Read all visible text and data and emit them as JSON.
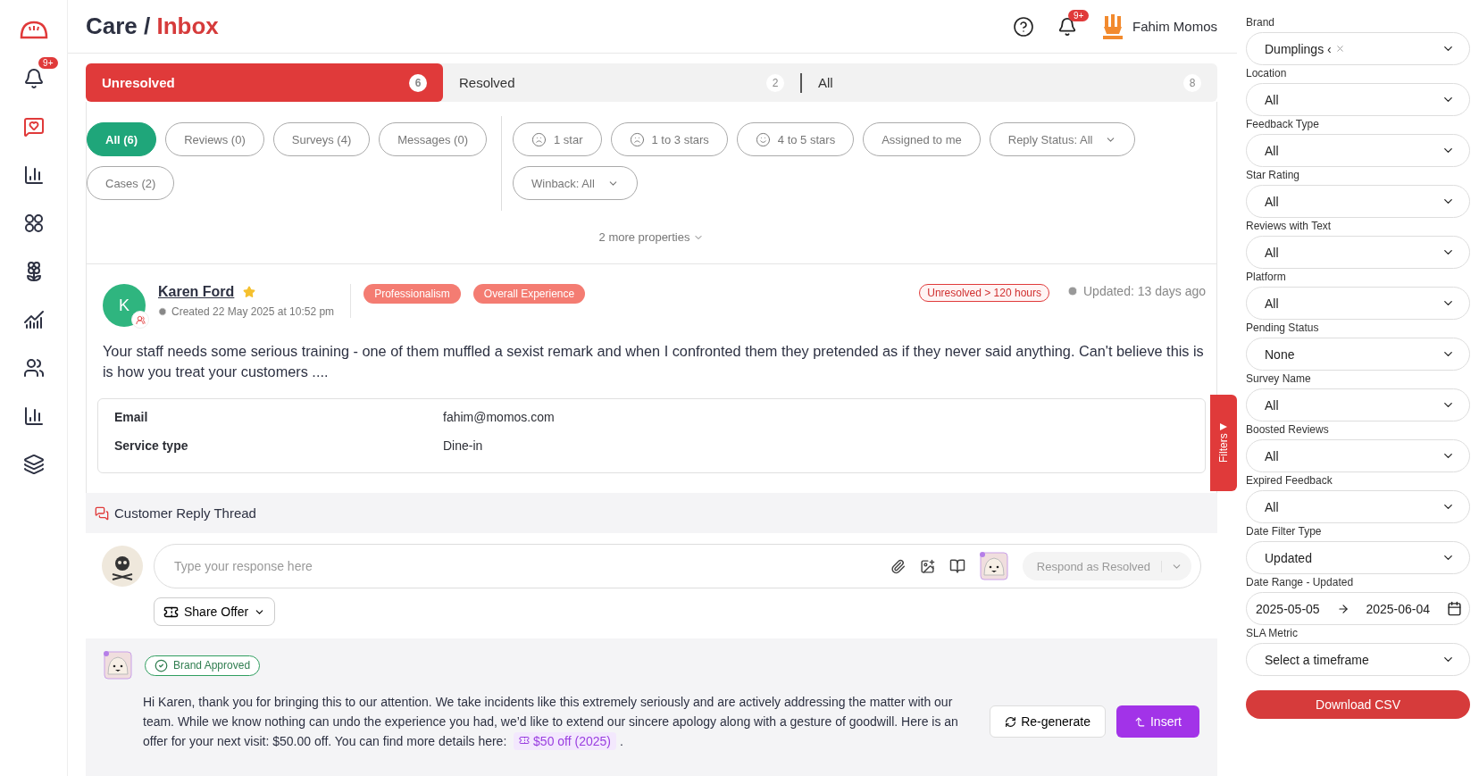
{
  "sidebar": {
    "items": [
      {
        "kind": "bell",
        "selected": false,
        "badge": "9+"
      },
      {
        "kind": "feedback",
        "selected": true
      },
      {
        "kind": "bars",
        "selected": false
      },
      {
        "kind": "apps",
        "selected": false
      },
      {
        "kind": "flower",
        "selected": false
      },
      {
        "kind": "growth",
        "selected": false
      },
      {
        "kind": "people",
        "selected": false
      },
      {
        "kind": "bars",
        "selected": false
      },
      {
        "kind": "layers",
        "selected": false
      }
    ]
  },
  "header": {
    "section": "Care /",
    "page": "Inbox",
    "notification_badge": "9+",
    "user_name": "Fahim Momos"
  },
  "status_tabs": [
    {
      "label": "Unresolved",
      "count": "6",
      "selected": true
    },
    {
      "label": "Resolved",
      "count": "2",
      "selected": false
    },
    {
      "label": "All",
      "count": "8",
      "selected": false
    }
  ],
  "type_chips": [
    {
      "label": "All (6)",
      "selected": true
    },
    {
      "label": "Reviews (0)",
      "selected": false
    },
    {
      "label": "Surveys (4)",
      "selected": false
    },
    {
      "label": "Messages (0)",
      "selected": false
    },
    {
      "label": "Cases (2)",
      "selected": false
    }
  ],
  "rating_chips": [
    {
      "label": "1 star",
      "kind": "sad"
    },
    {
      "label": "1 to 3 stars",
      "kind": "sad"
    },
    {
      "label": "4 to 5 stars",
      "kind": "happy"
    },
    {
      "label": "Assigned to me",
      "kind": "plain"
    },
    {
      "label": "Reply Status: All",
      "kind": "dropdown"
    },
    {
      "label": "Winback: All",
      "kind": "dropdown"
    }
  ],
  "more_properties": "2 more properties",
  "review": {
    "initial": "K",
    "name": "Karen Ford",
    "starred": true,
    "created": "Created 22 May 2025 at 10:52 pm",
    "tags": [
      "Professionalism",
      "Overall Experience"
    ],
    "sla": "Unresolved > 120 hours",
    "updated": "Updated: 13 days ago",
    "text": "Your staff needs some serious training - one of them muffled a sexist remark and when I confronted them they pretended as if they never said anything. Can't believe this is is how you treat your customers ....",
    "details": [
      {
        "label": "Email",
        "value": "fahim@momos.com"
      },
      {
        "label": "Service type",
        "value": "Dine-in"
      }
    ]
  },
  "filters_tab": "Filters",
  "reply_thread": {
    "title": "Customer Reply Thread",
    "placeholder": "Type your response here",
    "respond_button": "Respond as Resolved",
    "respond_disabled": true,
    "share_offer": "Share Offer"
  },
  "suggestion": {
    "badge": "Brand Approved",
    "text": "Hi Karen, thank you for bringing this to our attention. We take incidents like this extremely seriously and are actively addressing the matter with our team. While we know nothing can undo the experience you had, we’d like to extend our sincere apology along with a gesture of goodwill. Here is an offer for your next visit: $50.00 off. You can find more details here:",
    "offer": "$50 off (2025)",
    "text_after": ".",
    "regenerate": "Re-generate",
    "insert": "Insert"
  },
  "filters": [
    {
      "label": "Brand",
      "kind": "chip",
      "value": "Dumplings ‹"
    },
    {
      "label": "Location",
      "kind": "select",
      "value": "All"
    },
    {
      "label": "Feedback Type",
      "kind": "select",
      "value": "All"
    },
    {
      "label": "Star Rating",
      "kind": "select",
      "value": "All"
    },
    {
      "label": "Reviews with Text",
      "kind": "select",
      "value": "All"
    },
    {
      "label": "Platform",
      "kind": "select",
      "value": "All"
    },
    {
      "label": "Pending Status",
      "kind": "select",
      "value": "None"
    },
    {
      "label": "Survey Name",
      "kind": "select",
      "value": "All"
    },
    {
      "label": "Boosted Reviews",
      "kind": "select",
      "value": "All"
    },
    {
      "label": "Expired Feedback",
      "kind": "select",
      "value": "All"
    },
    {
      "label": "Date Filter Type",
      "kind": "select",
      "value": "Updated"
    },
    {
      "label": "Date Range - Updated",
      "kind": "daterange",
      "value": "2025-05-05",
      "value_end": "2025-06-04"
    },
    {
      "label": "SLA Metric",
      "kind": "select",
      "value": "Select a timeframe"
    }
  ],
  "download_button": "Download CSV"
}
